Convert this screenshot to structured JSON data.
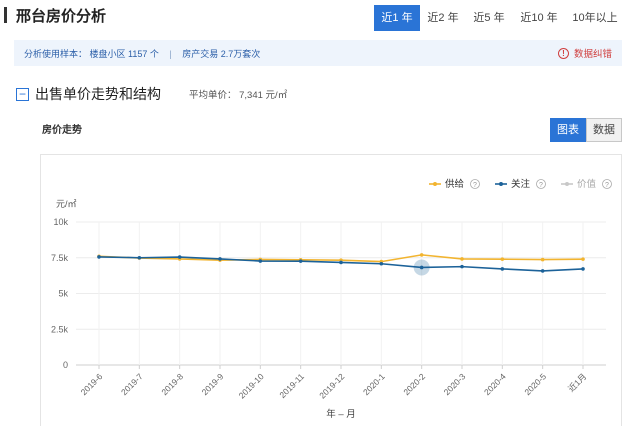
{
  "header": {
    "title": "邢台房价分析",
    "range_tabs": [
      "近1 年",
      "近2 年",
      "近5 年",
      "近10 年",
      "10年以上"
    ],
    "active_range": 0
  },
  "info": {
    "sample_text": "分析使用样本：  楼盘小区 1157 个",
    "separator": "|",
    "transaction_text": "房产交易 2.7万套次",
    "report_icon_glyph": "!",
    "report_label": "数据纠错"
  },
  "section": {
    "collapse_glyph": "−",
    "title": "出售单价走势和结构",
    "avg_price": "平均单价： 7,341 元/㎡"
  },
  "subsection": {
    "title": "房价走势",
    "view_buttons": [
      "图表",
      "数据"
    ],
    "active_view": 0
  },
  "chart_data": {
    "type": "line",
    "title": "",
    "xlabel": "年 – 月",
    "ylabel": "元/㎡",
    "categories": [
      "2019-6",
      "2019-7",
      "2019-8",
      "2019-9",
      "2019-10",
      "2019-11",
      "2019-12",
      "2020-1",
      "2020-2",
      "2020-3",
      "2020-4",
      "2020-5",
      "近1月"
    ],
    "ylim": [
      0,
      10000
    ],
    "yticks": [
      0,
      2500,
      5000,
      7500,
      10000
    ],
    "ytick_labels": [
      "0",
      "2.5k",
      "5k",
      "7.5k",
      "10k"
    ],
    "legend_position": "top-right",
    "help_glyph": "?",
    "series": [
      {
        "name": "供给",
        "color": "#f2b42f",
        "visible": true,
        "values": [
          7600,
          7480,
          7420,
          7330,
          7380,
          7360,
          7330,
          7230,
          7700,
          7420,
          7400,
          7370,
          7400
        ]
      },
      {
        "name": "关注",
        "color": "#1c6299",
        "visible": true,
        "values": [
          7560,
          7500,
          7550,
          7420,
          7270,
          7260,
          7170,
          7080,
          6820,
          6880,
          6720,
          6580,
          6720
        ]
      },
      {
        "name": "价值",
        "color": "#c8c8c8",
        "visible": false,
        "values": []
      }
    ],
    "highlight": {
      "series": 1,
      "index": 8
    },
    "grid": true
  }
}
